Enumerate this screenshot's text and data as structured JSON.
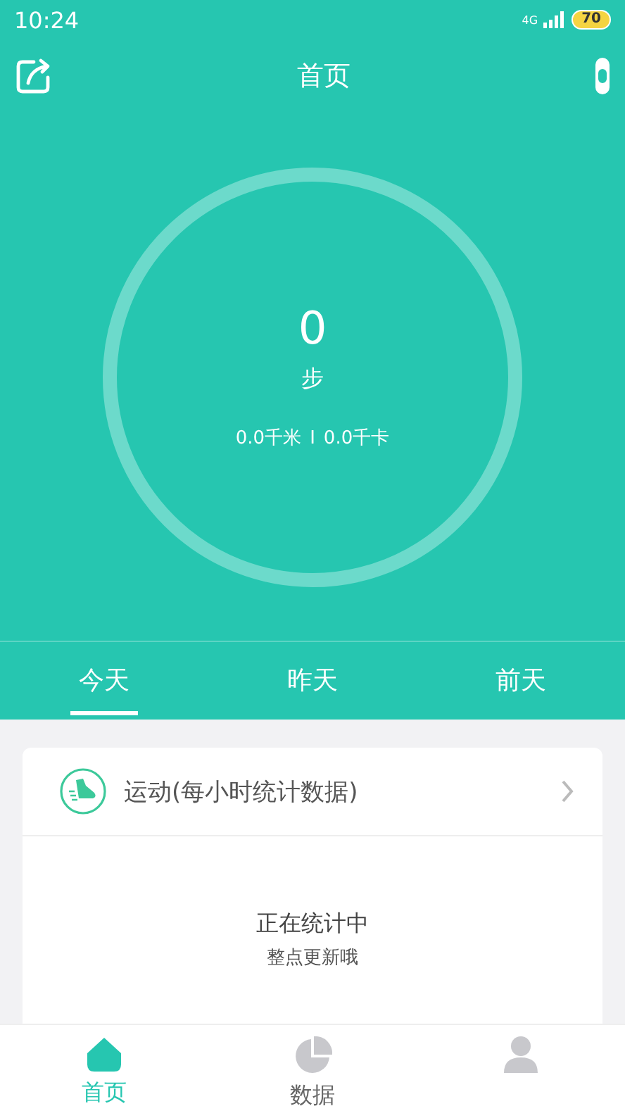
{
  "status_bar": {
    "time": "10:24",
    "network": "4G",
    "battery": "70"
  },
  "header": {
    "title": "首页"
  },
  "summary": {
    "steps": "0",
    "unit": "步",
    "distance": "0.0千米",
    "separator": "I",
    "calories": "0.0千卡"
  },
  "day_tabs": [
    {
      "label": "今天",
      "selected": true
    },
    {
      "label": "昨天",
      "selected": false
    },
    {
      "label": "前天",
      "selected": false
    }
  ],
  "card": {
    "title": "运动(每小时统计数据)",
    "status": "正在统计中",
    "hint": "整点更新哦"
  },
  "bottom_nav": [
    {
      "kind": "home",
      "label": "首页",
      "selected": true
    },
    {
      "kind": "data",
      "label": "数据",
      "selected": false
    },
    {
      "kind": "profile",
      "selected": false
    }
  ]
}
